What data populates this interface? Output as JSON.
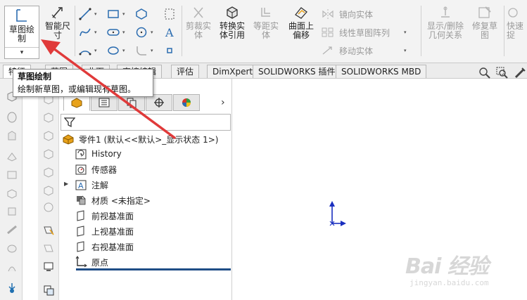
{
  "ribbon": {
    "sketch_label": "草图绘\n制",
    "smart_dim_label": "智能尺\n寸",
    "trim_label": "剪裁实\n体",
    "convert_label": "转换实\n体引用",
    "offset_label": "等距实\n体",
    "surface_offset_label": "曲面上\n偏移",
    "mirror_label": "镜向实体",
    "linear_pattern_label": "线性草图阵列",
    "move_label": "移动实体",
    "show_delete_label": "显示/删除\n几何关系",
    "repair_label": "修复草\n图",
    "quick_label": "快速\n捉",
    "dropdown_glyph": "▾"
  },
  "tabs": [
    {
      "label": "特征"
    },
    {
      "label": "草图"
    },
    {
      "label": "曲面"
    },
    {
      "label": "直接编辑"
    },
    {
      "label": "评估"
    },
    {
      "label": "DimXpert"
    },
    {
      "label": "SOLIDWORKS 插件"
    },
    {
      "label": "SOLIDWORKS MBD"
    }
  ],
  "tooltip": {
    "title": "草图绘制",
    "description": "绘制新草图，或编辑现有草图。"
  },
  "tree": {
    "root": "零件1 (默认<<默认>_显示状态 1>)",
    "items": [
      {
        "label": "History"
      },
      {
        "label": "传感器"
      },
      {
        "label": "注解"
      },
      {
        "label": "材质 <未指定>"
      },
      {
        "label": "前视基准面"
      },
      {
        "label": "上视基准面"
      },
      {
        "label": "右视基准面"
      },
      {
        "label": "原点"
      }
    ]
  },
  "panel": {
    "chevron": "›"
  },
  "watermark": {
    "main": "Bai 经验",
    "sub": "jingyan.baidu.com"
  },
  "colors": {
    "accent": "#1f4d86",
    "arrow": "#e03a3a",
    "triad": "#1a2fbf",
    "icon_orange": "#e8a21a"
  }
}
